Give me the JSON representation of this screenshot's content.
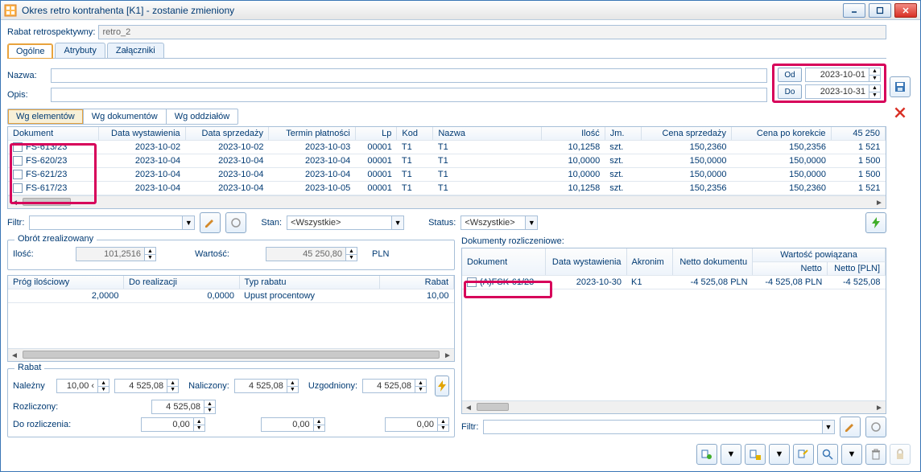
{
  "window": {
    "title": "Okres retro kontrahenta [K1] - zostanie zmieniony"
  },
  "header": {
    "rabat_label": "Rabat retrospektywny:",
    "rabat_value": "retro_2"
  },
  "tabs": {
    "general": "Ogólne",
    "attrs": "Atrybuty",
    "attachments": "Załączniki"
  },
  "fields": {
    "name_label": "Nazwa:",
    "desc_label": "Opis:"
  },
  "dates": {
    "od_label": "Od",
    "od_value": "2023-10-01",
    "do_label": "Do",
    "do_value": "2023-10-31"
  },
  "subtabs": {
    "elements": "Wg elementów",
    "docs": "Wg dokumentów",
    "branches": "Wg oddziałów"
  },
  "grid": {
    "headers": {
      "dokument": "Dokument",
      "data_wyst": "Data wystawienia",
      "data_spr": "Data sprzedaży",
      "termin": "Termin płatności",
      "lp": "Lp",
      "kod": "Kod",
      "nazwa": "Nazwa",
      "ilosc": "Ilość",
      "jm": "Jm.",
      "cena_sprz": "Cena sprzedaży",
      "cena_kor": "Cena po korekcie",
      "total": "45 250"
    },
    "rows": [
      {
        "dokument": "FS-613/23",
        "dw": "2023-10-02",
        "ds": "2023-10-02",
        "tp": "2023-10-03",
        "lp": "00001",
        "kod": "T1",
        "nazwa": "T1",
        "ilosc": "10,1258",
        "jm": "szt.",
        "cs": "150,2360",
        "ck": "150,2356",
        "t": "1 521"
      },
      {
        "dokument": "FS-620/23",
        "dw": "2023-10-04",
        "ds": "2023-10-04",
        "tp": "2023-10-04",
        "lp": "00001",
        "kod": "T1",
        "nazwa": "T1",
        "ilosc": "10,0000",
        "jm": "szt.",
        "cs": "150,0000",
        "ck": "150,0000",
        "t": "1 500"
      },
      {
        "dokument": "FS-621/23",
        "dw": "2023-10-04",
        "ds": "2023-10-04",
        "tp": "2023-10-04",
        "lp": "00001",
        "kod": "T1",
        "nazwa": "T1",
        "ilosc": "10,0000",
        "jm": "szt.",
        "cs": "150,0000",
        "ck": "150,0000",
        "t": "1 500"
      },
      {
        "dokument": "FS-617/23",
        "dw": "2023-10-04",
        "ds": "2023-10-04",
        "tp": "2023-10-05",
        "lp": "00001",
        "kod": "T1",
        "nazwa": "T1",
        "ilosc": "10,1258",
        "jm": "szt.",
        "cs": "150,2356",
        "ck": "150,2360",
        "t": "1 521"
      }
    ]
  },
  "filterbar": {
    "filter_label": "Filtr:",
    "stan_label": "Stan:",
    "stan_value": "<Wszystkie>",
    "status_label": "Status:",
    "status_value": "<Wszystkie>"
  },
  "obrot": {
    "legend": "Obrót zrealizowany",
    "ilosc_label": "Ilość:",
    "ilosc_value": "101,2516",
    "wartosc_label": "Wartość:",
    "wartosc_value": "45 250,80",
    "currency": "PLN"
  },
  "prog": {
    "h1": "Próg ilościowy",
    "h2": "Do realizacji",
    "h3": "Typ rabatu",
    "h4": "Rabat",
    "v1": "2,0000",
    "v2": "0,0000",
    "v3": "Upust procentowy",
    "v4": "10,00"
  },
  "rabat": {
    "legend": "Rabat",
    "nalezny": "Należny",
    "nalezny_v1": "10,00 ‹",
    "nalezny_v2": "4 525,08",
    "naliczony": "Naliczony:",
    "naliczony_v": "4 525,08",
    "uzgodniony": "Uzgodniony:",
    "uzgodniony_v": "4 525,08",
    "rozliczony": "Rozliczony:",
    "rozliczony_v": "4 525,08",
    "do_rozl": "Do rozliczenia:",
    "zero": "0,00"
  },
  "docr": {
    "legend": "Dokumenty rozliczeniowe:",
    "h_dok": "Dokument",
    "h_dw": "Data wystawienia",
    "h_ak": "Akronim",
    "h_netto": "Netto dokumentu",
    "h_wp": "Wartość powiązana",
    "h_netto2": "Netto",
    "h_nettopln": "Netto [PLN]",
    "row": {
      "dok": "(A)FSK-61/23",
      "dw": "2023-10-30",
      "ak": "K1",
      "nd": "-4 525,08 PLN",
      "n": "-4 525,08 PLN",
      "npln": "-4 525,08"
    },
    "filter_label": "Filtr:"
  }
}
